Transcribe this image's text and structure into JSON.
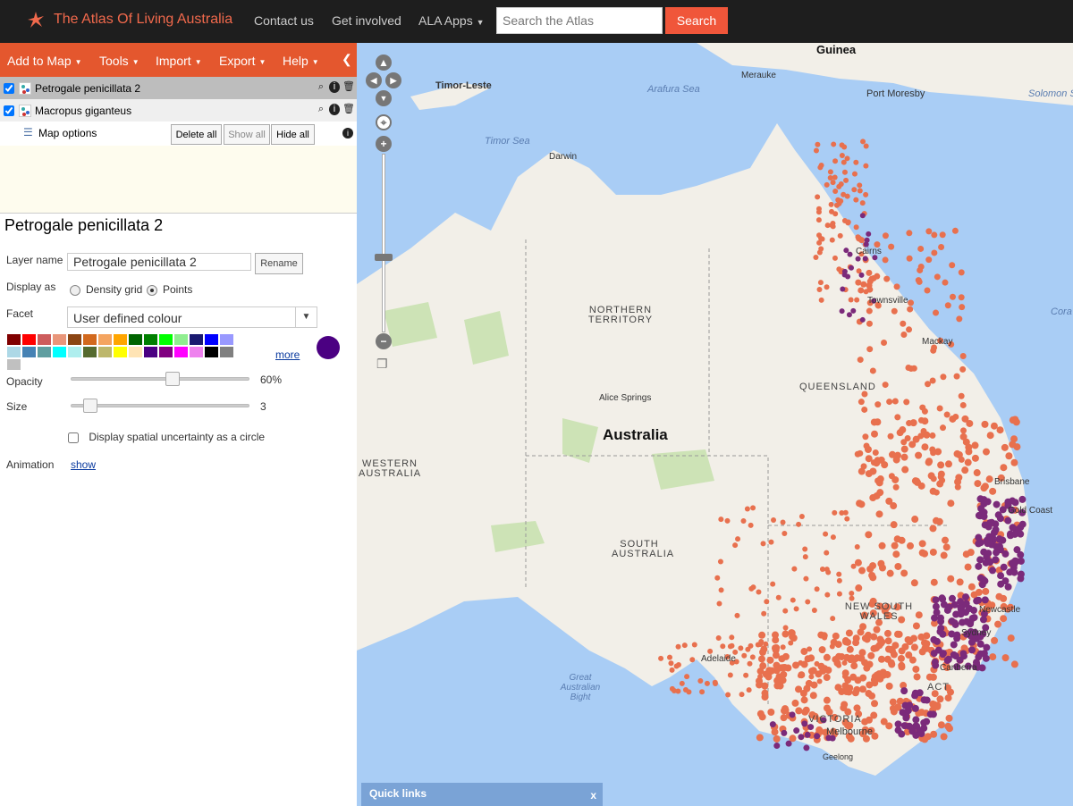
{
  "topnav": {
    "brand": "The Atlas Of Living Australia",
    "links": [
      "Contact us",
      "Get involved",
      "ALA Apps"
    ],
    "search_placeholder": "Search the Atlas",
    "search_button": "Search"
  },
  "menubar": {
    "items": [
      "Add to Map",
      "Tools",
      "Import",
      "Export",
      "Help"
    ]
  },
  "layers": [
    {
      "label": "Petrogale penicillata 2",
      "checked": true
    },
    {
      "label": "Macropus giganteus",
      "checked": true
    }
  ],
  "map_options": {
    "label": "Map options",
    "delete_all": "Delete all",
    "show_all": "Show all",
    "hide_all": "Hide all"
  },
  "panel": {
    "title": "Petrogale penicillata 2",
    "layer_name_label": "Layer name",
    "layer_name_value": "Petrogale penicillata 2",
    "rename": "Rename",
    "display_as_label": "Display as",
    "density_grid": "Density grid",
    "points": "Points",
    "facet_label": "Facet",
    "facet_value": "User defined colour",
    "more": "more",
    "selected_color": "#4b0082",
    "opacity_label": "Opacity",
    "opacity_value": "60%",
    "opacity_fraction": 0.6,
    "size_label": "Size",
    "size_value": "3",
    "uncertainty_label": "Display spatial uncertainty as a circle",
    "animation_label": "Animation",
    "animation_link": "show"
  },
  "swatches": [
    "#800000",
    "#ff0000",
    "#cd5c5c",
    "#e9967a",
    "#8b4513",
    "#d2691e",
    "#f4a460",
    "#ffa500",
    "#006400",
    "#008000",
    "#00ff00",
    "#90ee90",
    "#191970",
    "#0000ff",
    "#9999ff",
    "#add8e6",
    "#4682b4",
    "#5f9ea0",
    "#00ffff",
    "#afeeee",
    "#556b2f",
    "#bdb76b",
    "#ffff00",
    "#ffe4b5",
    "#4b0082",
    "#800080",
    "#ff00ff",
    "#ee82ee",
    "#000000",
    "#808080",
    "#c0c0c0"
  ],
  "map": {
    "labels": {
      "guinea": "Guinea",
      "merauke": "Merauke",
      "timor_leste": "Timor-Leste",
      "arafura": "Arafura Sea",
      "port_moresby": "Port Moresby",
      "solomon": "Solomon S",
      "timor_sea": "Timor Sea",
      "darwin": "Darwin",
      "cairns": "Cairns",
      "townsville": "Townsville",
      "coral": "Cora",
      "northern_territory": "NORTHERN TERRITORY",
      "mackay": "Mackay",
      "queensland": "QUEENSLAND",
      "alice_springs": "Alice Springs",
      "australia": "Australia",
      "western_australia": "WESTERN AUSTRALIA",
      "brisbane": "Brisbane",
      "gold_coast": "Gold Coast",
      "south_australia": "SOUTH AUSTRALIA",
      "nsw": "NEW SOUTH WALES",
      "newcastle": "Newcastle",
      "sydney": "Sydney",
      "adelaide": "Adelaide",
      "canberra": "Canberra",
      "act": "ACT",
      "great_bight": "Great Australian Bight",
      "victoria": "VICTORIA",
      "melbourne": "Melbourne",
      "geelong": "Geelong"
    }
  },
  "quick_links": {
    "label": "Quick links",
    "close": "x"
  }
}
